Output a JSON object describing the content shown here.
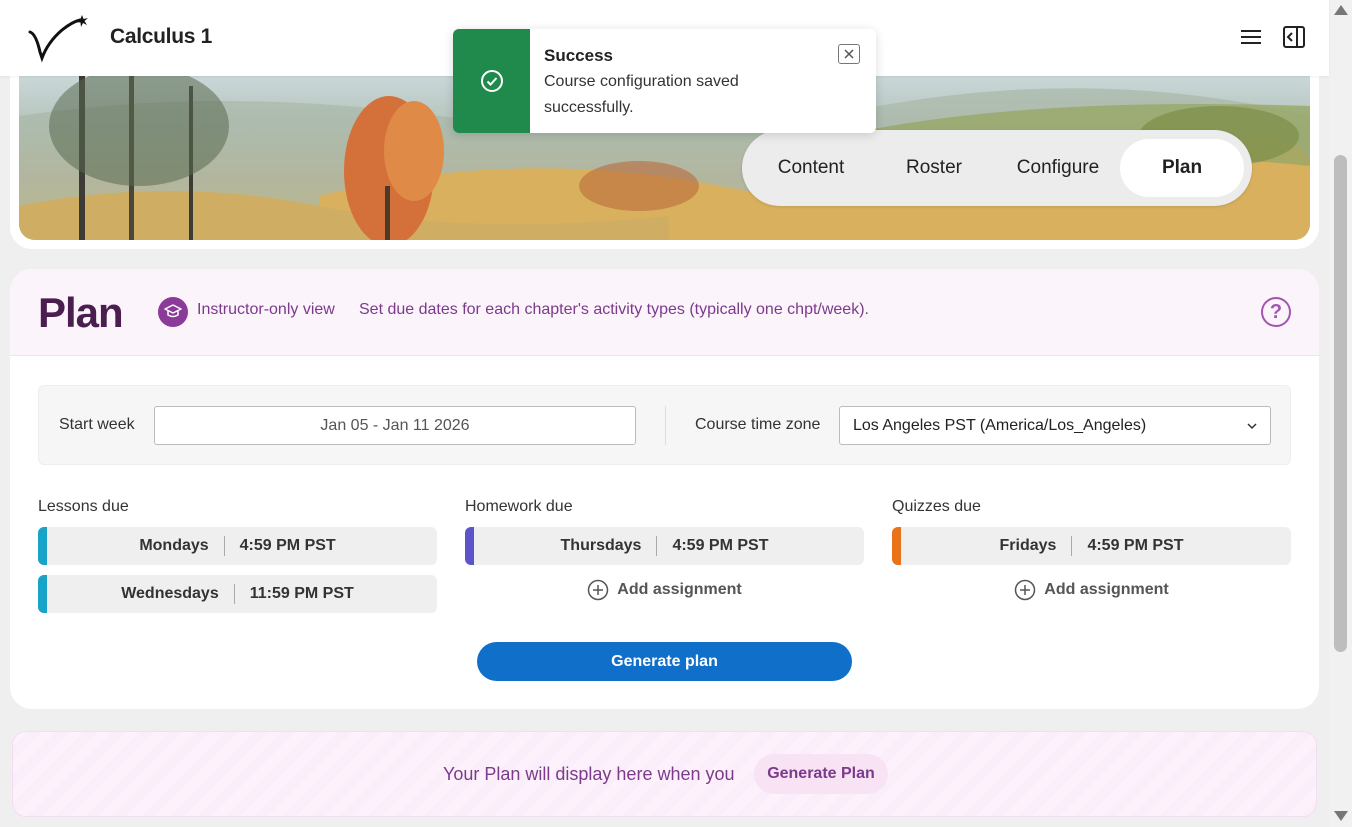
{
  "header": {
    "course_title": "Calculus 1"
  },
  "toast": {
    "title": "Success",
    "message": "Course configuration saved successfully.",
    "color": "#1f8a4c"
  },
  "tabs": [
    {
      "label": "Content",
      "active": false
    },
    {
      "label": "Roster",
      "active": false
    },
    {
      "label": "Configure",
      "active": false
    },
    {
      "label": "Plan",
      "active": true
    }
  ],
  "plan": {
    "title": "Plan",
    "instructor_label": "Instructor-only view",
    "description": "Set due dates for each chapter's activity types (typically one chpt/week).",
    "start_week_label": "Start week",
    "start_week_value": "Jan 05 - Jan 11 2026",
    "timezone_label": "Course time zone",
    "timezone_value": "Los Angeles PST (America/Los_Angeles)",
    "lessons": {
      "label": "Lessons due",
      "color": "#1aa3c9",
      "items": [
        {
          "day": "Mondays",
          "time": "4:59 PM PST"
        },
        {
          "day": "Wednesdays",
          "time": "11:59 PM PST"
        }
      ]
    },
    "homework": {
      "label": "Homework due",
      "color": "#5b55c9",
      "items": [
        {
          "day": "Thursdays",
          "time": "4:59 PM PST"
        }
      ],
      "add_label": "Add assignment"
    },
    "quizzes": {
      "label": "Quizzes due",
      "color": "#e8731a",
      "items": [
        {
          "day": "Fridays",
          "time": "4:59 PM PST"
        }
      ],
      "add_label": "Add assignment"
    },
    "generate_label": "Generate plan"
  },
  "placeholder": {
    "text": "Your Plan will display here when you",
    "button_label": "Generate Plan"
  },
  "theme": {
    "primary": "#0f6fc9",
    "plan_title_color": "#4a1e4e",
    "accent_purple": "#7c3a8c"
  }
}
